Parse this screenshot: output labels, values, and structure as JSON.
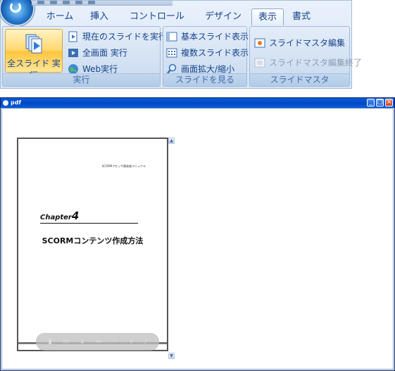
{
  "ribbon": {
    "tabs": [
      "ホーム",
      "挿入",
      "コントロール",
      "デザイン",
      "表示",
      "書式"
    ],
    "active_tab": "表示",
    "groups": {
      "run": {
        "label": "実行",
        "big_button": "全スライド 実行",
        "items": [
          "現在のスライドを実行",
          "全画面 実行",
          "Web実行"
        ]
      },
      "view": {
        "label": "スライドを見る",
        "items": [
          "基本スライド表示",
          "複数スライド表示",
          "画面拡大/縮小"
        ]
      },
      "master": {
        "label": "スライドマスタ",
        "items": [
          "スライドマスタ編集",
          "スライドマスタ編集終了"
        ]
      }
    }
  },
  "window": {
    "title": "pdf",
    "document": {
      "header_text": "SCORMアセッサ開発者マニュアル",
      "chapter_word": "Chapter",
      "chapter_number": "4",
      "title": "SCORMコンテンツ作成方法"
    },
    "controls": {
      "minimize": "_",
      "maximize": "□",
      "close": "×"
    }
  }
}
